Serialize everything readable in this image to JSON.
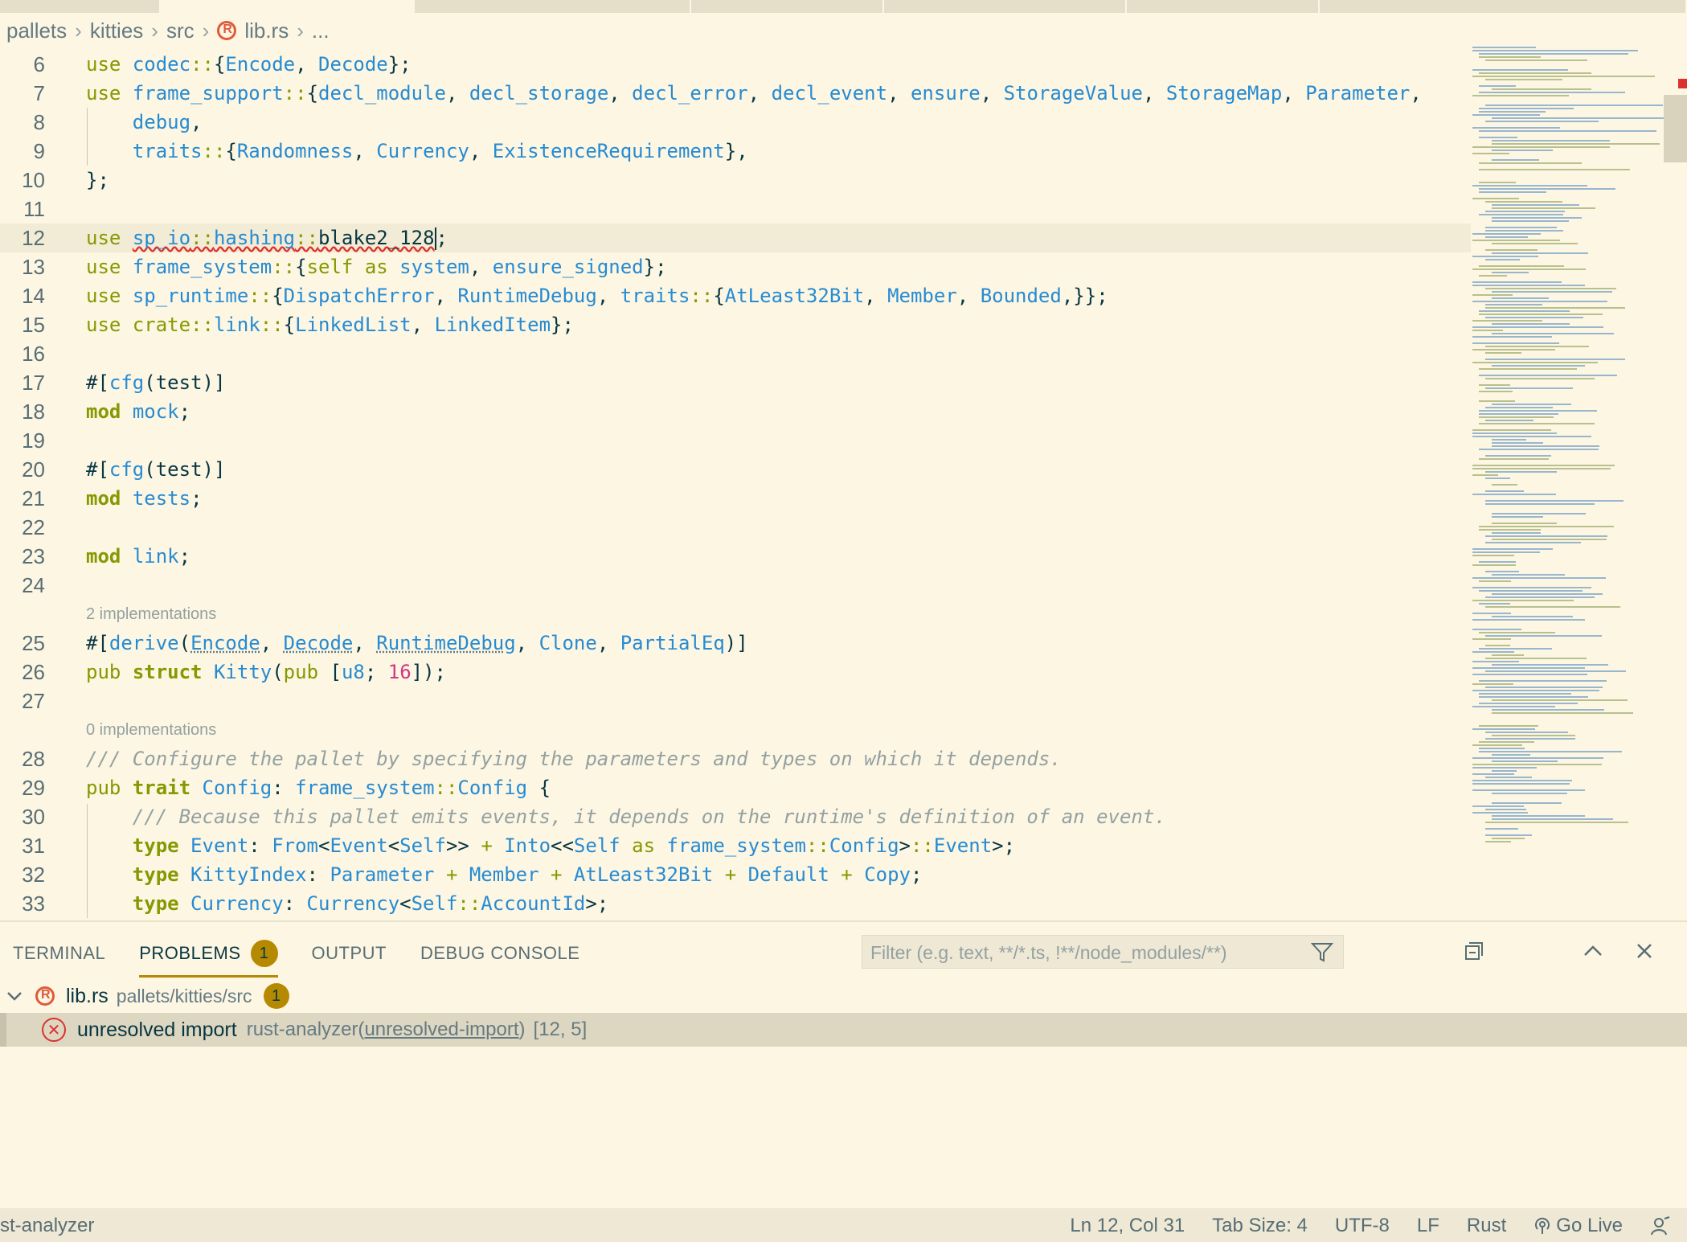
{
  "breadcrumb": [
    "pallets",
    "kitties",
    "src",
    "lib.rs",
    "..."
  ],
  "editor": {
    "current_line": 12,
    "codelens": {
      "before_25": "2 implementations",
      "before_28": "0 implementations"
    },
    "line_numbers": [
      "6",
      "7",
      "8",
      "9",
      "10",
      "11",
      "12",
      "13",
      "14",
      "15",
      "16",
      "17",
      "18",
      "19",
      "20",
      "21",
      "22",
      "23",
      "24",
      "25",
      "26",
      "27",
      "28",
      "29",
      "30",
      "31",
      "32",
      "33"
    ]
  },
  "panel": {
    "tabs": [
      "TERMINAL",
      "PROBLEMS",
      "OUTPUT",
      "DEBUG CONSOLE"
    ],
    "active_tab": "PROBLEMS",
    "problems_count": "1",
    "filter_placeholder": "Filter (e.g. text, **/*.ts, !**/node_modules/**)",
    "file": {
      "name": "lib.rs",
      "path": "pallets/kitties/src",
      "count": "1"
    },
    "problem": {
      "message": "unresolved import",
      "source_prefix": "rust-analyzer(",
      "source_code": "unresolved-import",
      "source_suffix": ")",
      "location": "[12, 5]"
    }
  },
  "statusbar": {
    "left": "st-analyzer",
    "position": "Ln 12, Col 31",
    "tab_size": "Tab Size: 4",
    "encoding": "UTF-8",
    "eol": "LF",
    "language": "Rust",
    "go_live": "Go Live"
  },
  "colors": {
    "background": "#fdf6e3",
    "accent": "#b58900",
    "error": "#dc322f",
    "keyword": "#859900",
    "type": "#268bd2"
  }
}
